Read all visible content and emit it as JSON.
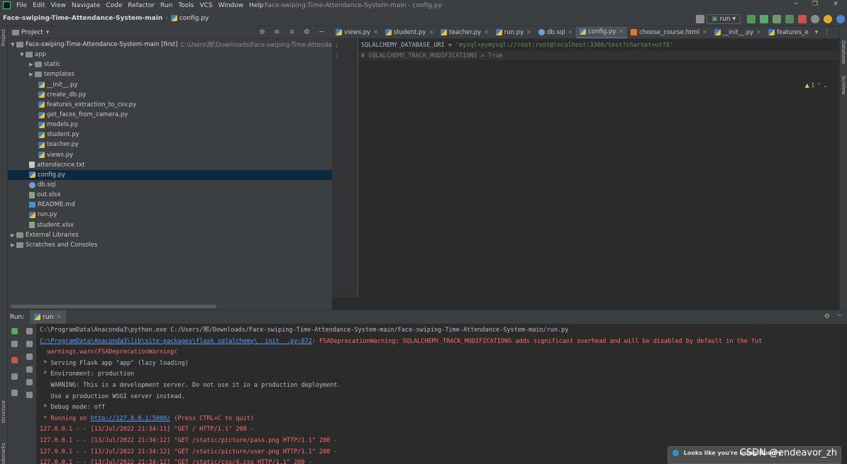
{
  "menubar": {
    "items": [
      "File",
      "Edit",
      "View",
      "Navigate",
      "Code",
      "Refactor",
      "Run",
      "Tools",
      "VCS",
      "Window",
      "Help"
    ],
    "window_title": "Face-swiping-Time-Attendance-System-main - config.py"
  },
  "navbar": {
    "project": "Face-swiping-Time-Attendance-System-main",
    "file": "config.py",
    "run_config": "run"
  },
  "project_panel": {
    "title": "Project",
    "root_label": "Face-swiping-Time-Attendance-System-main [first]",
    "root_path": "C:\\Users\\邢\\Downloads\\Face-swiping-Time-Attenda",
    "app": "app",
    "static": "static",
    "templates": "templates",
    "app_files": [
      "__init__.py",
      "create_db.py",
      "features_extraction_to_csv.py",
      "get_faces_from_camera.py",
      "models.py",
      "student.py",
      "teacher.py",
      "views.py"
    ],
    "root_files": [
      "attendacnce.txt",
      "config.py",
      "db.sql",
      "out.xlsx",
      "README.md",
      "run.py",
      "student.xlsx"
    ],
    "external": "External Libraries",
    "scratches": "Scratches and Consoles"
  },
  "editor": {
    "tabs": [
      "views.py",
      "student.py",
      "teacher.py",
      "run.py",
      "db.sql",
      "config.py",
      "choose_course.html",
      "__init__.py",
      "features_e"
    ],
    "active_tab": "config.py",
    "line_numbers": [
      "1",
      "2"
    ],
    "line1_key": "SQLALCHEMY_DATABASE_URI = ",
    "line1_value": "'mysql+pymysql://root:root@localhost:3306/test?charset=utf8'",
    "line2": "# SQLALCHEMY_TRACK_MODIFICATIONS = True",
    "warning_count": "1"
  },
  "run_panel": {
    "label": "Run:",
    "tab": "run",
    "lines": [
      {
        "text": "C:\\ProgramData\\Anaconda3\\python.exe C:/Users/邢/Downloads/Face-swiping-Time-Attendance-System-main/Face-swiping-Time-Attendance-System-main/run.py",
        "style": "gray"
      },
      {
        "text": "C:\\ProgramData\\Anaconda3\\lib\\site-packages\\flask_sqlalchemy\\__init__.py:872: FSADeprecationWarning: SQLALCHEMY_TRACK_MODIFICATIONS adds significant overhead and will be disabled by default in the fut",
        "style": "red"
      },
      {
        "text": "  warnings.warn(FSADeprecationWarning(",
        "style": "red"
      },
      {
        "text": " * Serving Flask app \"app\" (lazy loading)",
        "style": "gray"
      },
      {
        "text": " * Environment: production",
        "style": "gray"
      },
      {
        "text": "   WARNING: This is a development server. Do not use it in a production deployment.",
        "style": "gray"
      },
      {
        "text": "   Use a production WSGI server instead.",
        "style": "gray"
      },
      {
        "text": " * Debug mode: off",
        "style": "gray"
      },
      {
        "text": " * Running on http://127.0.0.1:5000/ (Press CTRL+C to quit)",
        "style": "red"
      },
      {
        "text": "127.0.0.1 - - [13/Jul/2022 21:34:11] \"GET / HTTP/1.1\" 200 -",
        "style": "red"
      },
      {
        "text": "127.0.0.1 - - [13/Jul/2022 21:34:12] \"GET /static/picture/pass.png HTTP/1.1\" 200 -",
        "style": "red"
      },
      {
        "text": "127.0.0.1 - - [13/Jul/2022 21:34:12] \"GET /static/picture/user.png HTTP/1.1\" 200 -",
        "style": "red"
      },
      {
        "text": "127.0.0.1 - - [13/Jul/2022 21:34:12] \"GET /static/css/4.css HTTP/1.1\" 200 -",
        "style": "red"
      }
    ]
  },
  "side_labels": {
    "project": "Project",
    "structure": "Structure",
    "bookmarks": "Bookmarks",
    "database": "Database",
    "sciview": "SciView"
  },
  "notification": "Looks like you're using NumPy",
  "watermark": "CSDN @endeavor_zh"
}
